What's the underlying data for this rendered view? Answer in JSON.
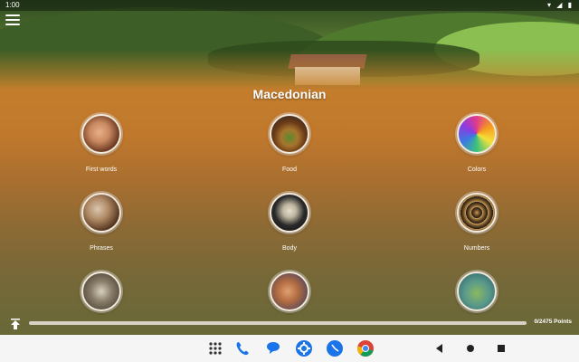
{
  "status": {
    "time": "1:00",
    "icons": "▾ ◢ ▮"
  },
  "title": "Macedonian",
  "categories": [
    {
      "label": "First words",
      "icon": "child-photo"
    },
    {
      "label": "Food",
      "icon": "burger-photo"
    },
    {
      "label": "Colors",
      "icon": "colors-photo"
    },
    {
      "label": "Phrases",
      "icon": "phrases-photo"
    },
    {
      "label": "Body",
      "icon": "skeleton-photo"
    },
    {
      "label": "Numbers",
      "icon": "numbers-photo"
    },
    {
      "label": "",
      "icon": "owl-photo"
    },
    {
      "label": "",
      "icon": "drink-photo"
    },
    {
      "label": "",
      "icon": "nature-photo"
    }
  ],
  "progress": {
    "points_text": "0/2475 Points",
    "value": 0.0
  },
  "taskbar": {
    "apps": [
      "apps-grid-icon",
      "phone-icon",
      "messages-icon",
      "settings-icon",
      "clock-icon",
      "chrome-icon"
    ],
    "nav": [
      "back-icon",
      "home-icon",
      "recents-icon"
    ]
  }
}
